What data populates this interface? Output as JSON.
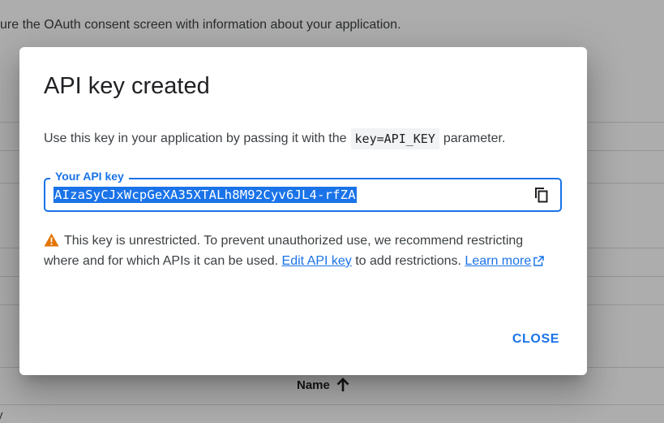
{
  "background": {
    "top_text": "ure the OAuth consent screen with information about your application.",
    "table_header_name": "Name",
    "bottom_text": "y"
  },
  "dialog": {
    "title": "API key created",
    "description_before": "Use this key in your application by passing it with the",
    "description_code": "key=API_KEY",
    "description_after": "parameter.",
    "field_label": "Your API key",
    "api_key": "AIzaSyCJxWcpGeXA35XTALh8M92Cyv6JL4-rfZA",
    "warning_text": "This key is unrestricted. To prevent unauthorized use, we recommend restricting where and for which APIs it can be used.",
    "edit_link": "Edit API key",
    "after_edit": "to add restrictions.",
    "learn_more": "Learn more",
    "close_label": "CLOSE"
  },
  "colors": {
    "accent": "#1a73e8",
    "warning": "#e37400"
  }
}
